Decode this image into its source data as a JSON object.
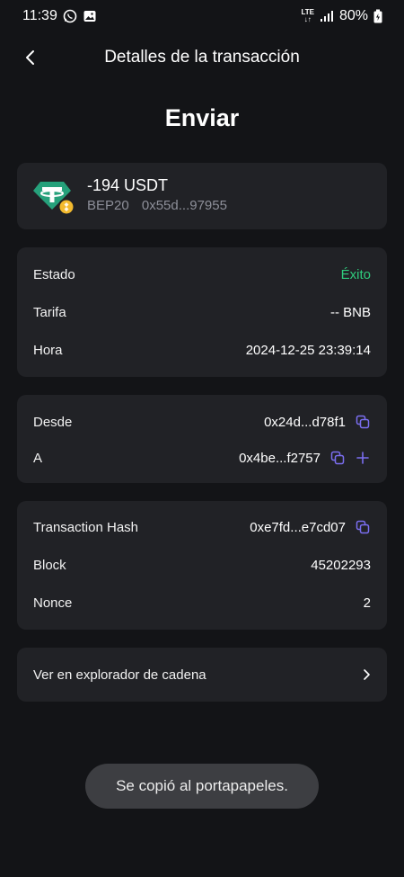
{
  "status_bar": {
    "time": "11:39",
    "network": "LTE",
    "battery": "80%"
  },
  "header": {
    "title": "Detalles de la transacción"
  },
  "page": {
    "title": "Enviar"
  },
  "asset": {
    "amount": "-194 USDT",
    "network": "BEP20",
    "address": "0x55d...97955"
  },
  "details": {
    "status_label": "Estado",
    "status_value": "Éxito",
    "fee_label": "Tarifa",
    "fee_value": "-- BNB",
    "time_label": "Hora",
    "time_value": "2024-12-25 23:39:14"
  },
  "parties": {
    "from_label": "Desde",
    "from_value": "0x24d...d78f1",
    "to_label": "A",
    "to_value": "0x4be...f2757"
  },
  "chain": {
    "hash_label": "Transaction Hash",
    "hash_value": "0xe7fd...e7cd07",
    "block_label": "Block",
    "block_value": "45202293",
    "nonce_label": "Nonce",
    "nonce_value": "2"
  },
  "explorer": {
    "label": "Ver en explorador de cadena"
  },
  "toast": {
    "text": "Se copió al portapapeles."
  },
  "colors": {
    "background": "#131417",
    "card": "#212226",
    "success": "#2fcb7d",
    "accent_icon": "#7b6ef0",
    "tether": "#26a17b",
    "bnb": "#f3ba2f"
  }
}
